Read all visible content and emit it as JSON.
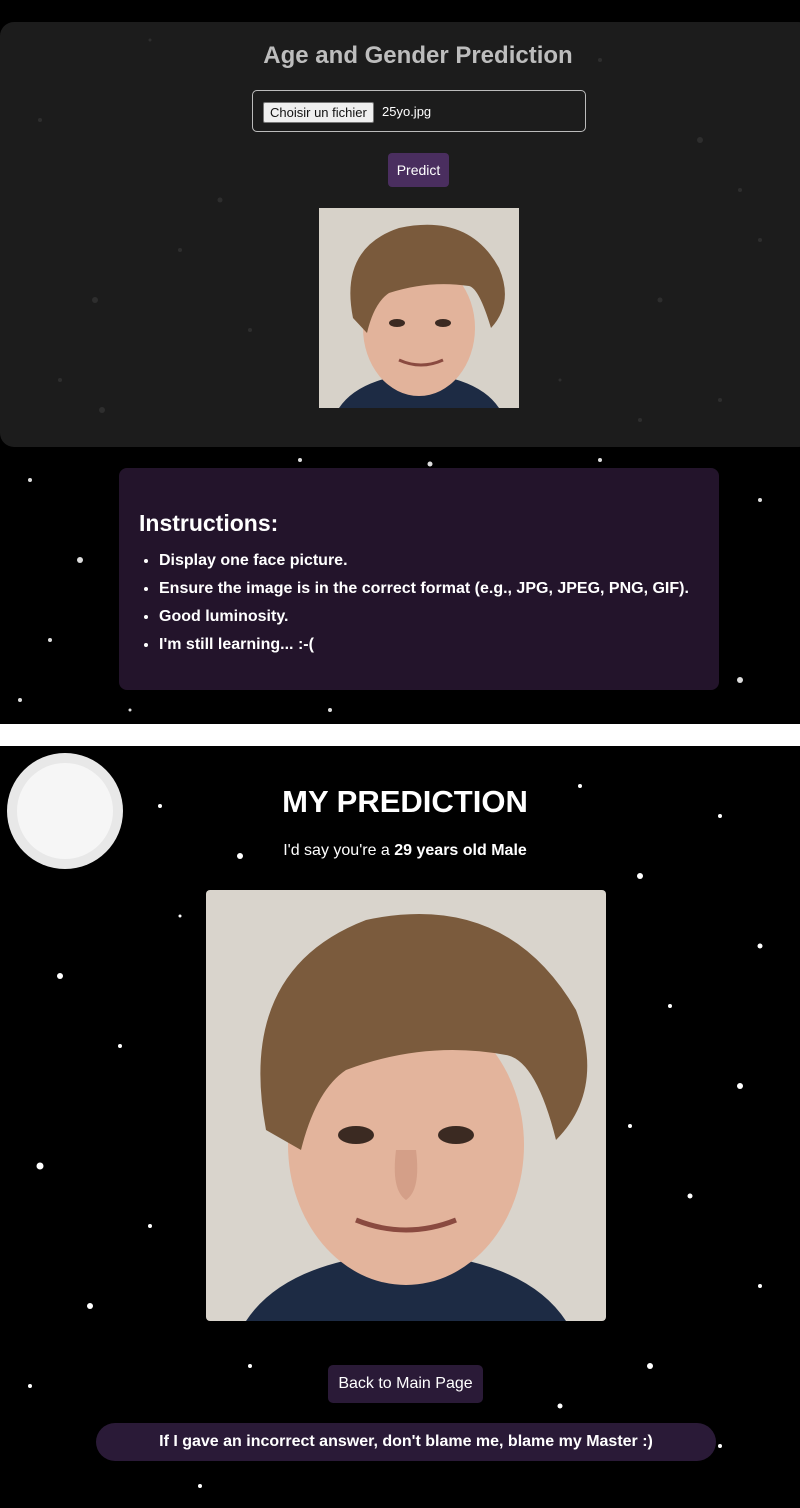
{
  "upload_panel": {
    "title": "Age and Gender Prediction",
    "file_button_label": "Choisir un fichier",
    "file_name": "25yo.jpg",
    "predict_label": "Predict"
  },
  "instructions": {
    "heading": "Instructions:",
    "items": [
      "Display one face picture.",
      "Ensure the image is in the correct format (e.g., JPG, JPEG, PNG, GIF).",
      "Good luminosity.",
      "I'm still learning... :-("
    ]
  },
  "result": {
    "title": "MY PREDICTION",
    "prefix": "I'd say you're a ",
    "prediction": "29 years old Male",
    "back_label": "Back to Main Page",
    "disclaimer": "If I gave an incorrect answer, don't blame me, blame my Master :)"
  },
  "colors": {
    "accent": "#4a2e5f",
    "button_dark": "#2a1a37",
    "panel": "#1e1e1e"
  }
}
